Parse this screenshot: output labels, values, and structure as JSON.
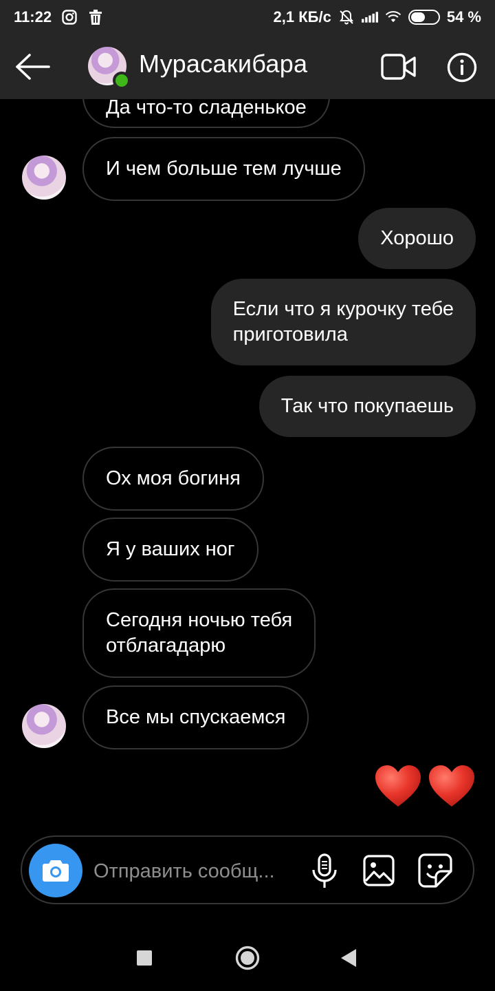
{
  "status_bar": {
    "time": "11:22",
    "network_speed": "2,1 КБ/с",
    "battery_percent": "54 %",
    "battery_level": 0.54,
    "icons": [
      "instagram-icon",
      "trash-icon",
      "bell-muted-icon",
      "signal-icon",
      "wifi-icon",
      "battery-icon"
    ]
  },
  "header": {
    "contact_name": "Мурасакибара",
    "online": true,
    "online_color": "#3fb619"
  },
  "messages": [
    {
      "side": "in",
      "text": "Да что-то сладенькое",
      "avatar": false
    },
    {
      "side": "in",
      "text": "И чем больше тем лучше",
      "avatar": true
    },
    {
      "side": "out",
      "text": "Хорошо"
    },
    {
      "side": "out",
      "text": "Если что я курочку тебе\nприготовила"
    },
    {
      "side": "out",
      "text": "Так что покупаешь"
    },
    {
      "side": "in",
      "text": "Ох моя богиня",
      "avatar": false
    },
    {
      "side": "in",
      "text": "Я у ваших ног",
      "avatar": false
    },
    {
      "side": "in",
      "text": "Сегодня ночью тебя\nотблагадарю",
      "avatar": false
    },
    {
      "side": "in",
      "text": "Все мы спускаемся",
      "avatar": true
    }
  ],
  "reaction": {
    "emoji": "❤️❤️",
    "count": 2,
    "color": "#e8352a"
  },
  "composer": {
    "placeholder": "Отправить сообщ...",
    "accent": "#3797f0"
  },
  "nav_bar": {
    "buttons": [
      "recents-button",
      "home-button",
      "back-button"
    ]
  }
}
